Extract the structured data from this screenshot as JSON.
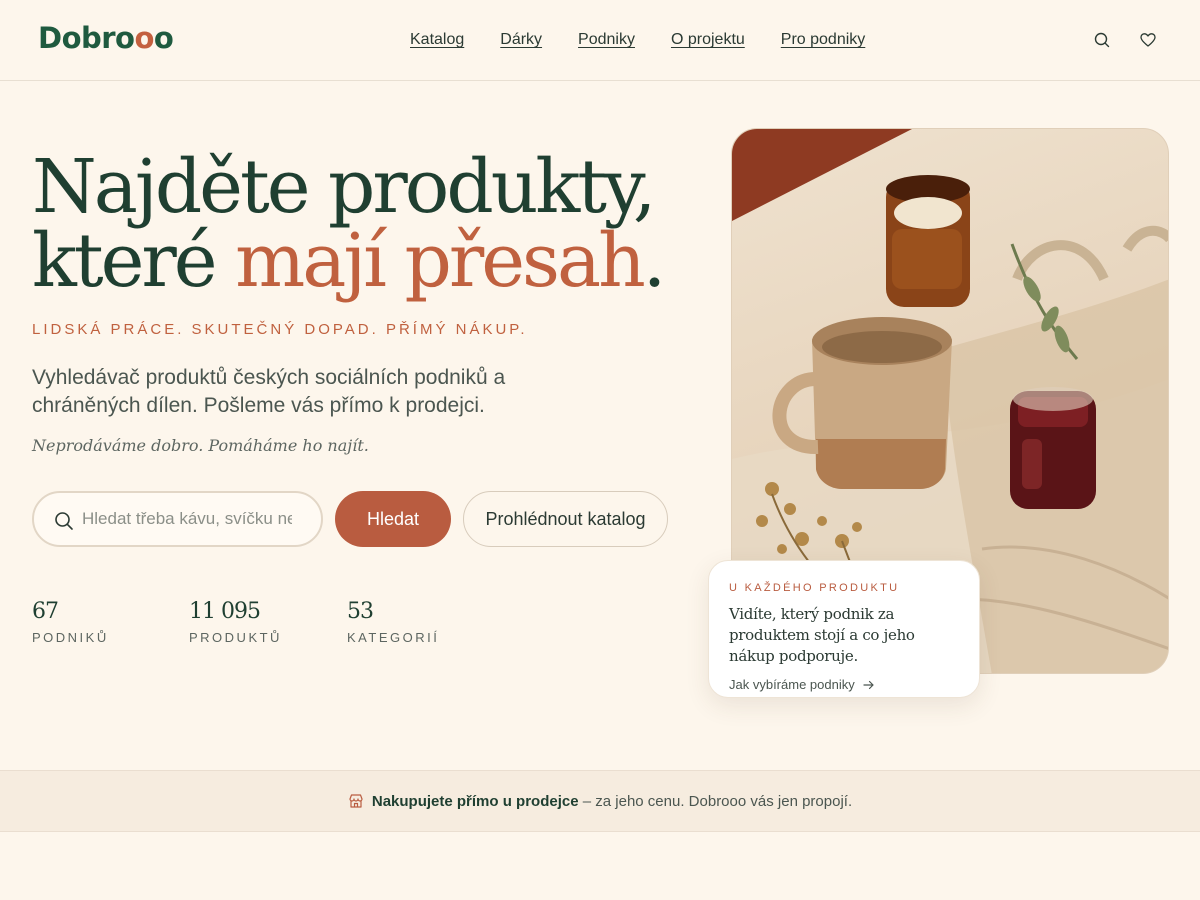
{
  "header": {
    "logo_main": "Dobro",
    "logo_accent": "o",
    "logo_end": "o",
    "nav": [
      "Katalog",
      "Dárky",
      "Podniky",
      "O projektu",
      "Pro podniky"
    ]
  },
  "hero": {
    "title_line1": "Najděte produkty,",
    "title_line2_pre": "které ",
    "title_line2_accent": "mají přesah",
    "title_line2_post": ".",
    "tagline": "LIDSKÁ PRÁCE. SKUTEČNÝ DOPAD. PŘÍMÝ NÁKUP.",
    "lead": "Vyhledávač produktů českých sociálních podniků a chráněných dílen. Pošleme vás přímo k prodejci.",
    "motto": "Neprodáváme dobro. Pomáháme ho najít."
  },
  "search": {
    "placeholder": "Hledat třeba kávu, svíčku nebo tašku",
    "button_label": "Hledat",
    "catalog_button_label": "Prohlédnout katalog"
  },
  "stats": [
    {
      "value": "67",
      "label": "PODNIKŮ"
    },
    {
      "value": "11 095",
      "label": "PRODUKTŮ"
    },
    {
      "value": "53",
      "label": "KATEGORIÍ"
    }
  ],
  "info_card": {
    "kicker": "U KAŽDÉHO PRODUKTU",
    "text": "Vidíte, který podnik za produktem stojí a co jeho nákup podporuje.",
    "link": "Jak vybíráme podniky"
  },
  "band": {
    "bold": "Nakupujete přímo u prodejce",
    "rest": "– za jeho cenu. Dobrooo vás jen propojí."
  },
  "colors": {
    "background": "#fdf6ec",
    "brand_green": "#1f5a3f",
    "accent": "#b95c40"
  }
}
